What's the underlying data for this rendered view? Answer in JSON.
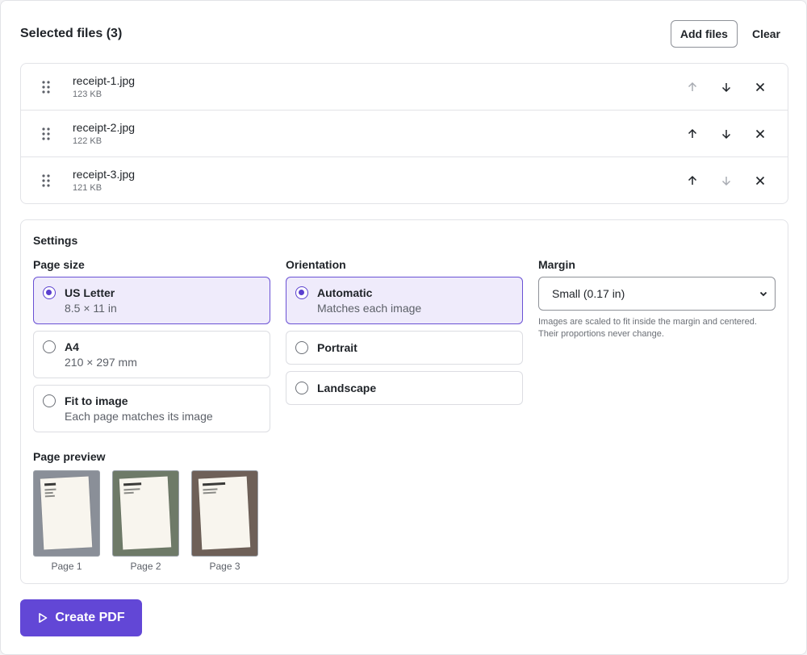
{
  "header": {
    "title": "Selected files (3)",
    "add_files_label": "Add files",
    "clear_label": "Clear"
  },
  "files": [
    {
      "name": "receipt-1.jpg",
      "size": "123 KB",
      "up_disabled": true,
      "down_disabled": false
    },
    {
      "name": "receipt-2.jpg",
      "size": "122 KB",
      "up_disabled": false,
      "down_disabled": false
    },
    {
      "name": "receipt-3.jpg",
      "size": "121 KB",
      "up_disabled": false,
      "down_disabled": true
    }
  ],
  "settings": {
    "title": "Settings",
    "page_size": {
      "label": "Page size",
      "options": [
        {
          "title": "US Letter",
          "subtitle": "8.5 × 11 in",
          "selected": true
        },
        {
          "title": "A4",
          "subtitle": "210 × 297 mm",
          "selected": false
        },
        {
          "title": "Fit to image",
          "subtitle": "Each page matches its image",
          "selected": false
        }
      ]
    },
    "orientation": {
      "label": "Orientation",
      "options": [
        {
          "title": "Automatic",
          "subtitle": "Matches each image",
          "selected": true
        },
        {
          "title": "Portrait",
          "selected": false
        },
        {
          "title": "Landscape",
          "selected": false
        }
      ]
    },
    "margin": {
      "label": "Margin",
      "selected": "Small (0.17 in)",
      "help": "Images are scaled to fit inside the margin and centered. Their proportions never change."
    }
  },
  "preview": {
    "label": "Page preview",
    "pages": [
      {
        "label": "Page 1",
        "bg": "#8a8f98"
      },
      {
        "label": "Page 2",
        "bg": "#6e7a68"
      },
      {
        "label": "Page 3",
        "bg": "#6e6058"
      }
    ]
  },
  "create_label": "Create PDF",
  "colors": {
    "accent": "#6247d6",
    "selected_bg": "#efebfb",
    "selected_border": "#6a51d4"
  }
}
